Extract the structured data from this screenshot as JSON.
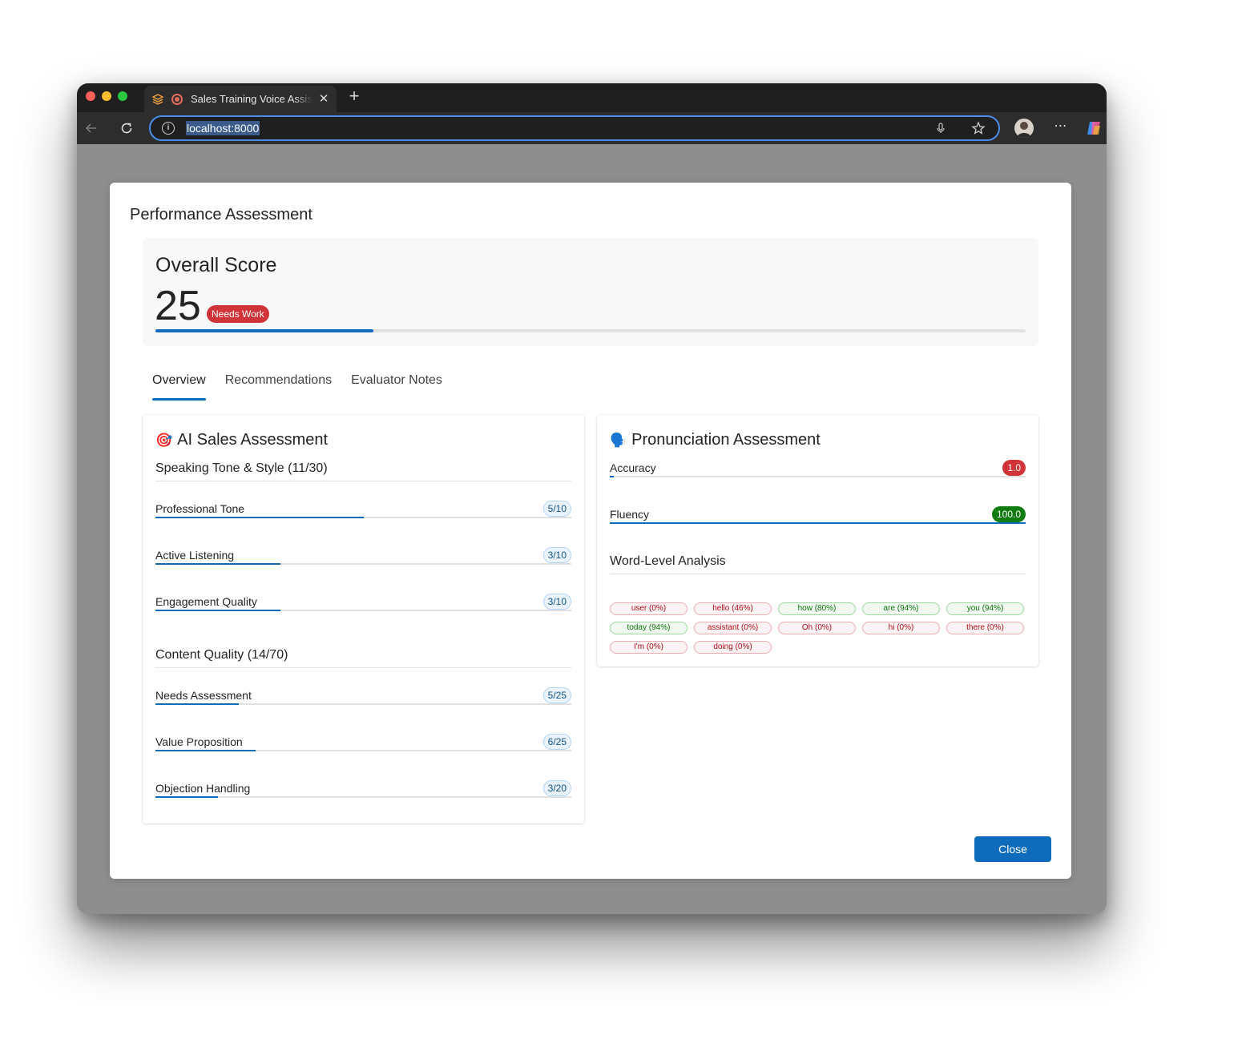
{
  "browser": {
    "tab_title": "Sales Training Voice Assistant",
    "url": "localhost:8000"
  },
  "modal": {
    "title": "Performance Assessment",
    "overall": {
      "heading": "Overall Score",
      "score": "25",
      "badge": "Needs Work",
      "progress_fraction": 0.25
    },
    "tabs": [
      "Overview",
      "Recommendations",
      "Evaluator Notes"
    ],
    "active_tab": "Overview",
    "ai_sales": {
      "title": "AI Sales Assessment",
      "icon": "target-icon",
      "sections": [
        {
          "heading": "Speaking Tone & Style (11/30)",
          "metrics": [
            {
              "label": "Professional Tone",
              "score": "5/10",
              "fraction": 0.5
            },
            {
              "label": "Active Listening",
              "score": "3/10",
              "fraction": 0.3
            },
            {
              "label": "Engagement Quality",
              "score": "3/10",
              "fraction": 0.3
            }
          ]
        },
        {
          "heading": "Content Quality (14/70)",
          "metrics": [
            {
              "label": "Needs Assessment",
              "score": "5/25",
              "fraction": 0.2
            },
            {
              "label": "Value Proposition",
              "score": "6/25",
              "fraction": 0.24
            },
            {
              "label": "Objection Handling",
              "score": "3/20",
              "fraction": 0.15
            }
          ]
        }
      ]
    },
    "pronunciation": {
      "title": "Pronunciation Assessment",
      "icon": "speaking-head-icon",
      "metrics": [
        {
          "label": "Accuracy",
          "value": "1.0",
          "fraction": 0.01,
          "color": "#d13438"
        },
        {
          "label": "Fluency",
          "value": "100.0",
          "fraction": 1.0,
          "color": "#107c10"
        }
      ],
      "word_heading": "Word-Level Analysis",
      "words": [
        {
          "text": "user (0%)",
          "status": "bad"
        },
        {
          "text": "hello (46%)",
          "status": "bad"
        },
        {
          "text": "how (80%)",
          "status": "good"
        },
        {
          "text": "are (94%)",
          "status": "good"
        },
        {
          "text": "you (94%)",
          "status": "good"
        },
        {
          "text": "today (94%)",
          "status": "good"
        },
        {
          "text": "assistant (0%)",
          "status": "bad"
        },
        {
          "text": "Oh (0%)",
          "status": "bad"
        },
        {
          "text": "hi (0%)",
          "status": "bad"
        },
        {
          "text": "there (0%)",
          "status": "bad"
        },
        {
          "text": "I'm (0%)",
          "status": "bad"
        },
        {
          "text": "doing (0%)",
          "status": "bad"
        }
      ]
    },
    "close_label": "Close"
  }
}
